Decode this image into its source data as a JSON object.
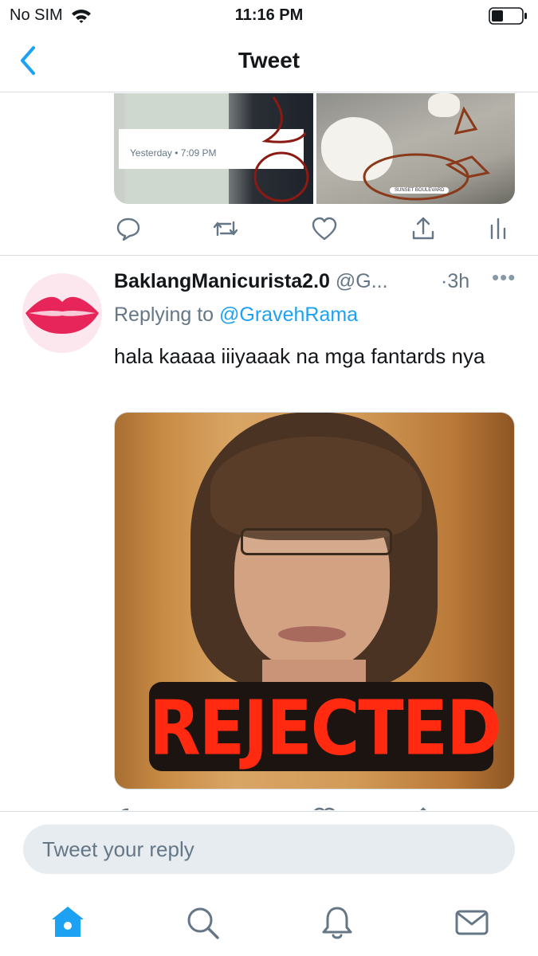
{
  "status_bar": {
    "carrier": "No SIM",
    "time": "11:16 PM"
  },
  "nav": {
    "title": "Tweet"
  },
  "previous_tweet": {
    "media_caption": "Yesterday • 7:09 PM",
    "media_location": "SUNSET BOULEVARD"
  },
  "tweet": {
    "display_name": "BaklangManicurista2.0",
    "handle": "@G...",
    "time": "·3h",
    "more": "•••",
    "replying_prefix": "Replying to",
    "replying_handle": "@GravehRama",
    "text": "hala kaaaa iiiyaaak na mga fantards nya",
    "media_text": "REJECTED"
  },
  "composer": {
    "placeholder": "Tweet your reply"
  },
  "colors": {
    "accent": "#1da1f2",
    "secondary_text": "#657786",
    "lips": "#e8255a"
  },
  "icons": {
    "nav": [
      "chevron-left-icon"
    ],
    "actions": [
      "reply-icon",
      "retweet-icon",
      "like-icon",
      "share-icon",
      "analytics-icon"
    ],
    "tabs": [
      "home-icon",
      "search-icon",
      "notifications-icon",
      "messages-icon"
    ]
  }
}
